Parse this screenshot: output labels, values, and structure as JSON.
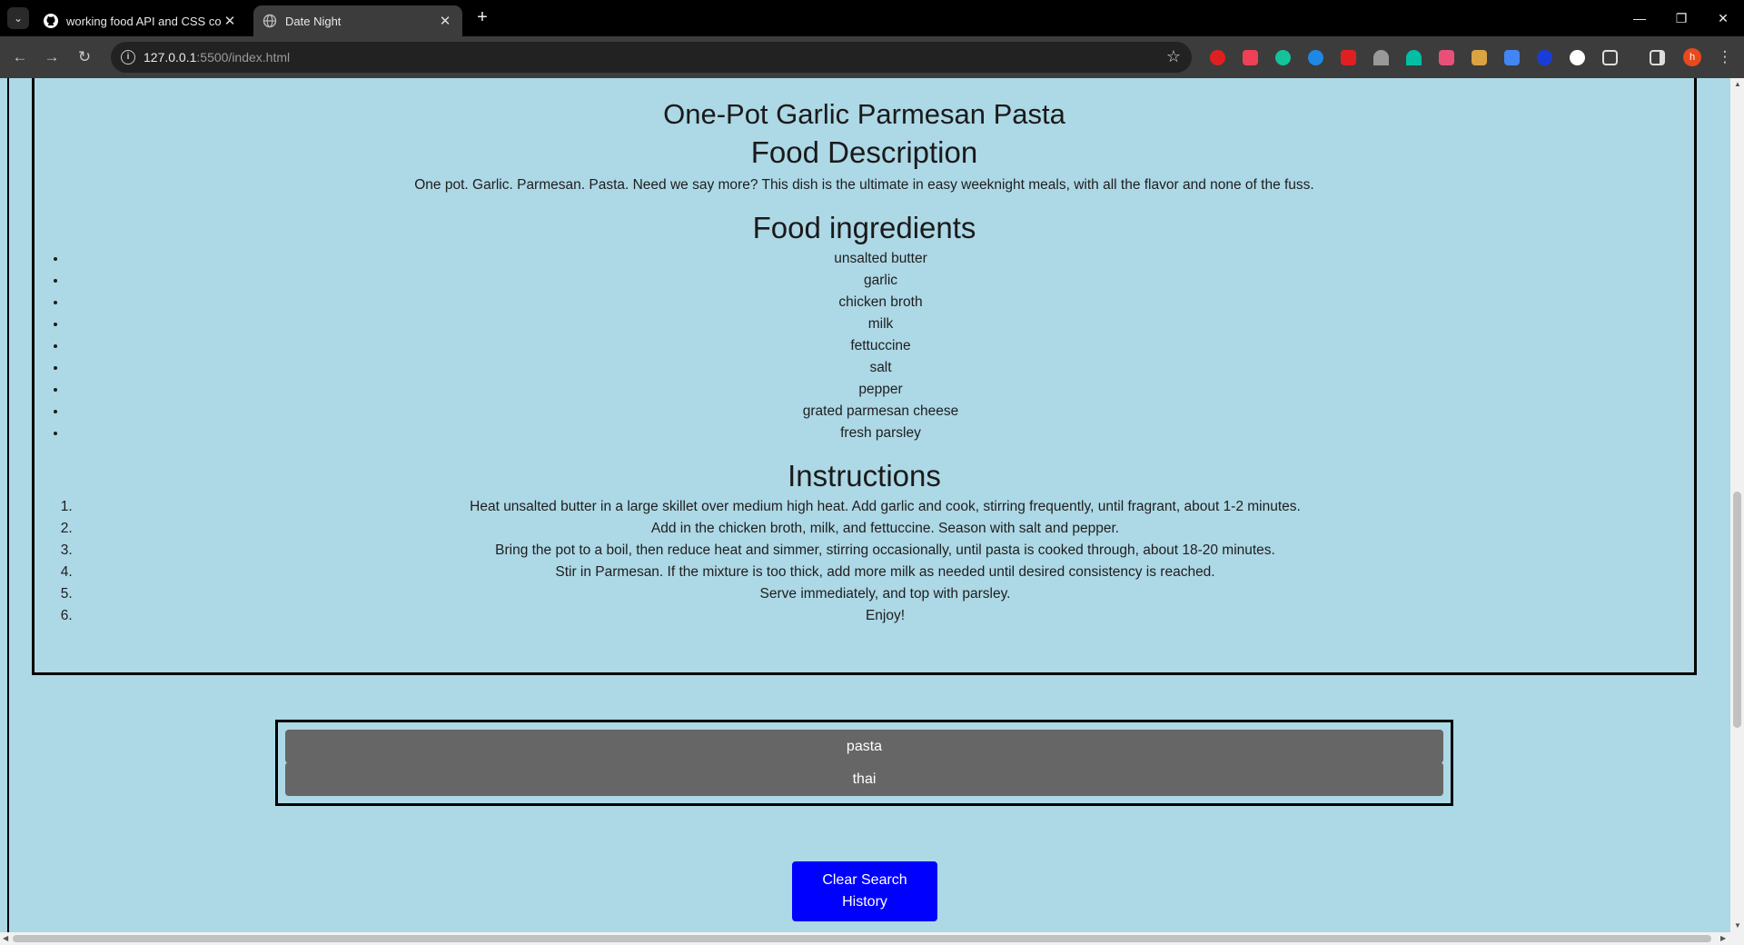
{
  "browser": {
    "tabs": [
      {
        "title": "working food API and CSS corr",
        "icon": "github-icon",
        "active": false
      },
      {
        "title": "Date Night",
        "icon": "globe-icon",
        "active": true
      }
    ],
    "url_host": "127.0.0.1",
    "url_rest": ":5500/index.html",
    "avatar_letter": "h"
  },
  "recipe": {
    "name": "One-Pot Garlic Parmesan Pasta",
    "description_heading": "Food Description",
    "description": "One pot. Garlic. Parmesan. Pasta. Need we say more? This dish is the ultimate in easy weeknight meals, with all the flavor and none of the fuss.",
    "ingredients_heading": "Food ingredients",
    "ingredients": [
      "unsalted butter",
      "garlic",
      "chicken broth",
      "milk",
      "fettuccine",
      "salt",
      "pepper",
      "grated parmesan cheese",
      "fresh parsley"
    ],
    "instructions_heading": "Instructions",
    "instructions": [
      "Heat unsalted butter in a large skillet over medium high heat. Add garlic and cook, stirring frequently, until fragrant, about 1-2 minutes.",
      "Add in the chicken broth, milk, and fettuccine. Season with salt and pepper.",
      "Bring the pot to a boil, then reduce heat and simmer, stirring occasionally, until pasta is cooked through, about 18-20 minutes.",
      "Stir in Parmesan. If the mixture is too thick, add more milk as needed until desired consistency is reached.",
      "Serve immediately, and top with parsley.",
      "Enjoy!"
    ]
  },
  "search_history": [
    "pasta",
    "thai"
  ],
  "clear_button_label": "Clear Search History",
  "colors": {
    "page_bg": "#add8e6",
    "history_button": "#666666",
    "clear_button": "#0000ff"
  }
}
